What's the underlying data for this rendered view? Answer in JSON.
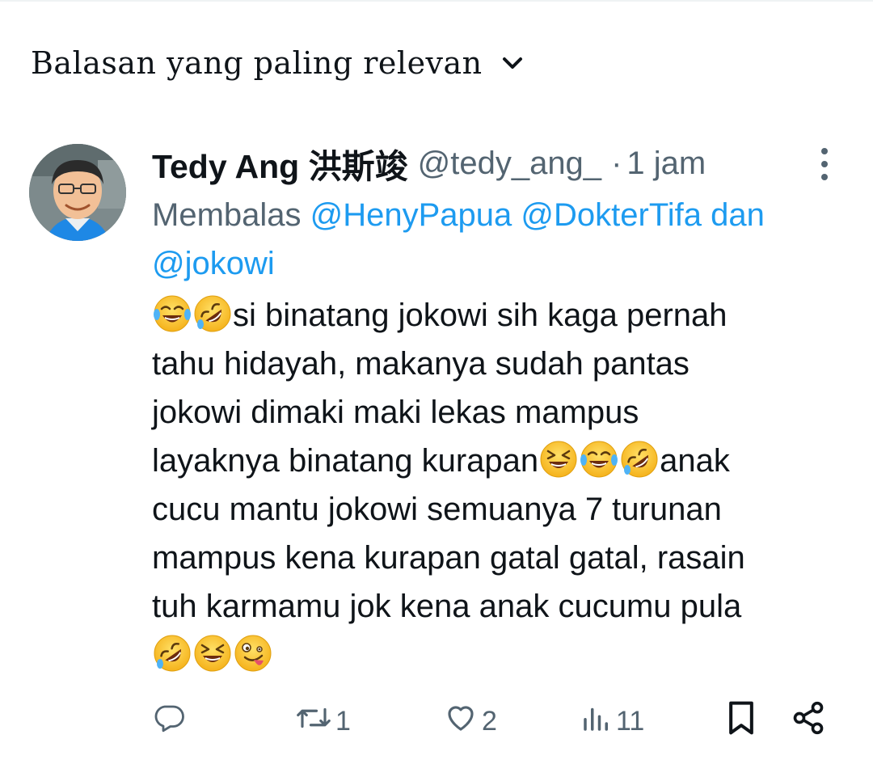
{
  "sort": {
    "label": "Balasan yang paling relevan",
    "icon": "chevron-down-icon"
  },
  "tweet": {
    "author_name": "Tedy Ang 洪斯竣",
    "handle": "@tedy_ang_",
    "separator": "·",
    "time": "1 jam",
    "reply_prefix": "Membalas",
    "mentions": [
      "@HenyPapua",
      "@DokterTifa",
      "@jokowi"
    ],
    "mention_joiner": "dan",
    "lines": [
      "si binatang jokowi sih kaga pernah",
      "tahu hidayah, makanya sudah pantas",
      "jokowi dimaki maki lekas mampus",
      "layaknya binatang kurapan",
      "anak",
      "cucu mantu jokowi semuanya 7 turunan",
      "mampus kena kurapan gatal gatal, rasain",
      "tuh karmamu jok kena anak cucumu pula"
    ],
    "emojis": {
      "line1": [
        "joy",
        "rofl"
      ],
      "line4": [
        "laughing",
        "joy",
        "rofl"
      ],
      "end": [
        "rofl",
        "laughing",
        "zany"
      ]
    }
  },
  "actions": {
    "reply": {
      "icon": "reply-icon",
      "count": ""
    },
    "retweet": {
      "icon": "retweet-icon",
      "count": "1"
    },
    "like": {
      "icon": "heart-icon",
      "count": "2"
    },
    "views": {
      "icon": "views-icon",
      "count": "11"
    },
    "bookmark": {
      "icon": "bookmark-icon"
    },
    "share": {
      "icon": "share-icon"
    }
  },
  "colors": {
    "link": "#1d9bf0",
    "secondary": "#536471",
    "text": "#0f1419",
    "emoji": "#fcc21b"
  }
}
